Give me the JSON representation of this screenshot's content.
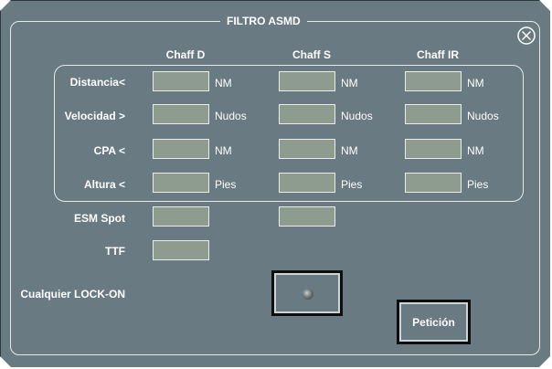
{
  "title": "FILTRO ASMD",
  "columns": [
    "Chaff D",
    "Chaff S",
    "Chaff IR"
  ],
  "rows": [
    {
      "label": "Distancia<",
      "unit": "NM"
    },
    {
      "label": "Velocidad >",
      "unit": "Nudos"
    },
    {
      "label": "CPA <",
      "unit": "NM"
    },
    {
      "label": "Altura <",
      "unit": "Pies"
    }
  ],
  "esm_spot": {
    "label": "ESM Spot"
  },
  "ttf": {
    "label": "TTF"
  },
  "lock_on": {
    "label": "Cualquier LOCK-ON"
  },
  "peticion": {
    "label": "Petición"
  },
  "icons": {
    "close": "close-icon",
    "indicator": "indicator-light-icon"
  },
  "colors": {
    "panel": "#6a7a82",
    "field": "#8e9c8f",
    "text": "#ffffff"
  }
}
